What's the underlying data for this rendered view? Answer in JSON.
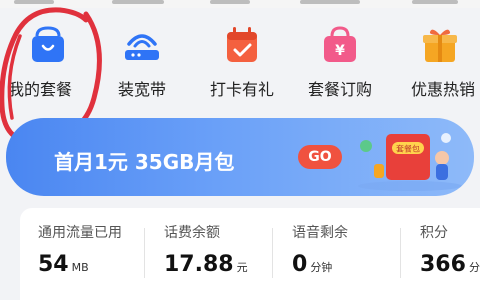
{
  "quick_actions": [
    {
      "label": "我的套餐",
      "icon": "shopping-bag-icon"
    },
    {
      "label": "装宽带",
      "icon": "router-icon"
    },
    {
      "label": "打卡有礼",
      "icon": "calendar-check-icon"
    },
    {
      "label": "套餐订购",
      "icon": "yuan-bag-icon"
    },
    {
      "label": "优惠热销",
      "icon": "gift-box-icon"
    }
  ],
  "banner": {
    "text": "首月1元  35GB月包",
    "button": "GO",
    "gift_label": "套餐包"
  },
  "stats": [
    {
      "title": "通用流量已用",
      "value": "54",
      "unit": "MB"
    },
    {
      "title": "话费余额",
      "value": "17.88",
      "unit": "元"
    },
    {
      "title": "语音剩余",
      "value": "0",
      "unit": "分钟"
    },
    {
      "title": "积分",
      "value": "366",
      "unit": "分"
    }
  ],
  "colors": {
    "accent_blue": "#4a86f1",
    "go_red": "#f0523f",
    "annotation_red": "#e0313d"
  }
}
